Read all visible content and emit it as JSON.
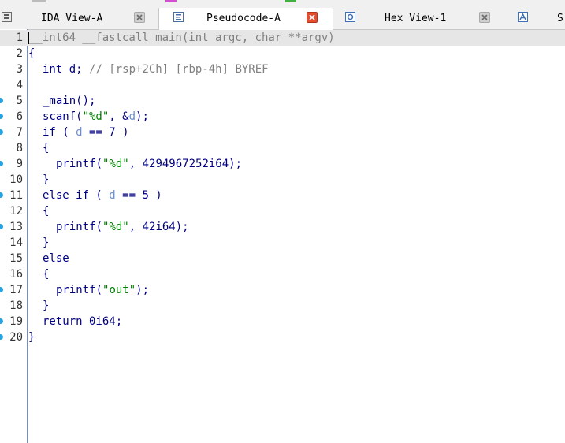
{
  "tabs": [
    {
      "label": "IDA View-A",
      "icon": "graph-view-icon",
      "active": false
    },
    {
      "label": "Pseudocode-A",
      "icon": "pseudocode-icon",
      "active": true
    },
    {
      "label": "Hex View-1",
      "icon": "hex-view-icon",
      "active": false
    },
    {
      "label": "S",
      "icon": "structures-icon",
      "active": false
    }
  ],
  "colors": {
    "active_close": "#e64d2e",
    "breakpoint": "#29a3e0",
    "keyword": "#000080",
    "variable": "#6a8fd0",
    "string": "#008000",
    "comment": "#808080"
  },
  "line_numbers": [
    "1",
    "2",
    "3",
    "4",
    "5",
    "6",
    "7",
    "8",
    "9",
    "10",
    "11",
    "12",
    "13",
    "14",
    "15",
    "16",
    "17",
    "18",
    "19",
    "20"
  ],
  "code": {
    "l1_sig": "__int64 __fastcall main(int argc, char **argv)",
    "l2": "{",
    "l3_decl": "int d;",
    "l3_comment": "// [rsp+2Ch] [rbp-4h] BYREF",
    "l5": "_main();",
    "l6_a": "scanf(",
    "l6_str": "\"%d\"",
    "l6_b": ", &",
    "l6_var": "d",
    "l6_c": ");",
    "l7_a": "if ( ",
    "l7_var": "d",
    "l7_b": " == 7 )",
    "l8": "{",
    "l9_a": "printf(",
    "l9_str": "\"%d\"",
    "l9_b": ", 4294967252i64);",
    "l10": "}",
    "l11_a": "else if ( ",
    "l11_var": "d",
    "l11_b": " == 5 )",
    "l12": "{",
    "l13_a": "printf(",
    "l13_str": "\"%d\"",
    "l13_b": ", 42i64);",
    "l14": "}",
    "l15": "else",
    "l16": "{",
    "l17_a": "printf(",
    "l17_str": "\"out\"",
    "l17_b": ");",
    "l18": "}",
    "l19": "return 0i64;",
    "l20": "}"
  }
}
